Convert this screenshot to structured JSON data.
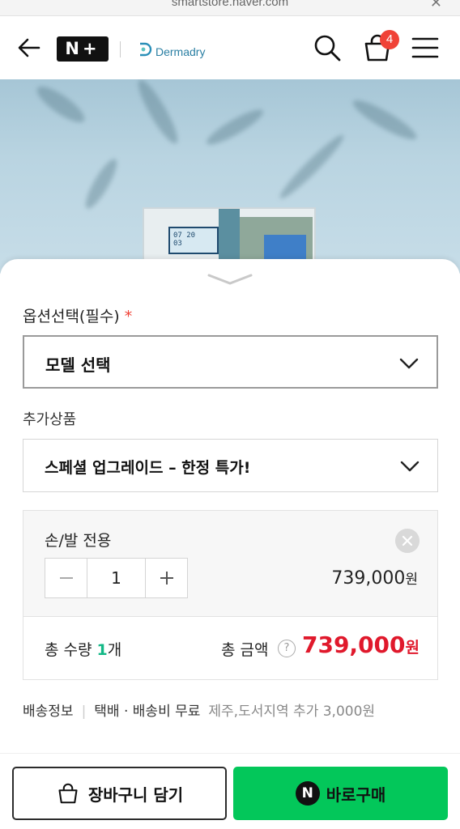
{
  "browser": {
    "url": "smartstore.naver.com",
    "close_icon": "close-icon"
  },
  "header": {
    "nplus_logo": "N+",
    "brand_name": "Dermadry",
    "cart_count": "4",
    "icons": [
      "back-arrow-icon",
      "search-icon",
      "cart-icon",
      "menu-icon"
    ]
  },
  "hero": {
    "device_screen_text": "07 20",
    "device_screen_sub": "03"
  },
  "options": {
    "required_label": "옵션선택(필수)",
    "required_mark": "*",
    "model_select_value": "모델 선택",
    "addon_label": "추가상품",
    "addon_select_value": "스페셜 업그레이드 – 한정 특가!"
  },
  "selected_item": {
    "name": "손/발 전용",
    "quantity": "1",
    "price": "739,000",
    "currency": "원"
  },
  "totals": {
    "qty_prefix": "총 수량",
    "qty_value": "1",
    "qty_suffix": "개",
    "amount_label": "총 금액",
    "help_mark": "?",
    "amount_value": "739,000",
    "currency": "원"
  },
  "shipping": {
    "label": "배송정보",
    "method": "택배 · 배송비 무료",
    "extra": "제주,도서지역 추가 3,000원"
  },
  "actions": {
    "cart_label": "장바구니 담기",
    "buy_label": "바로구매",
    "buy_logo": "N"
  },
  "colors": {
    "accent_red": "#e0192c",
    "naver_green": "#03c75a",
    "badge_red": "#f04237",
    "qty_green": "#12b886"
  }
}
